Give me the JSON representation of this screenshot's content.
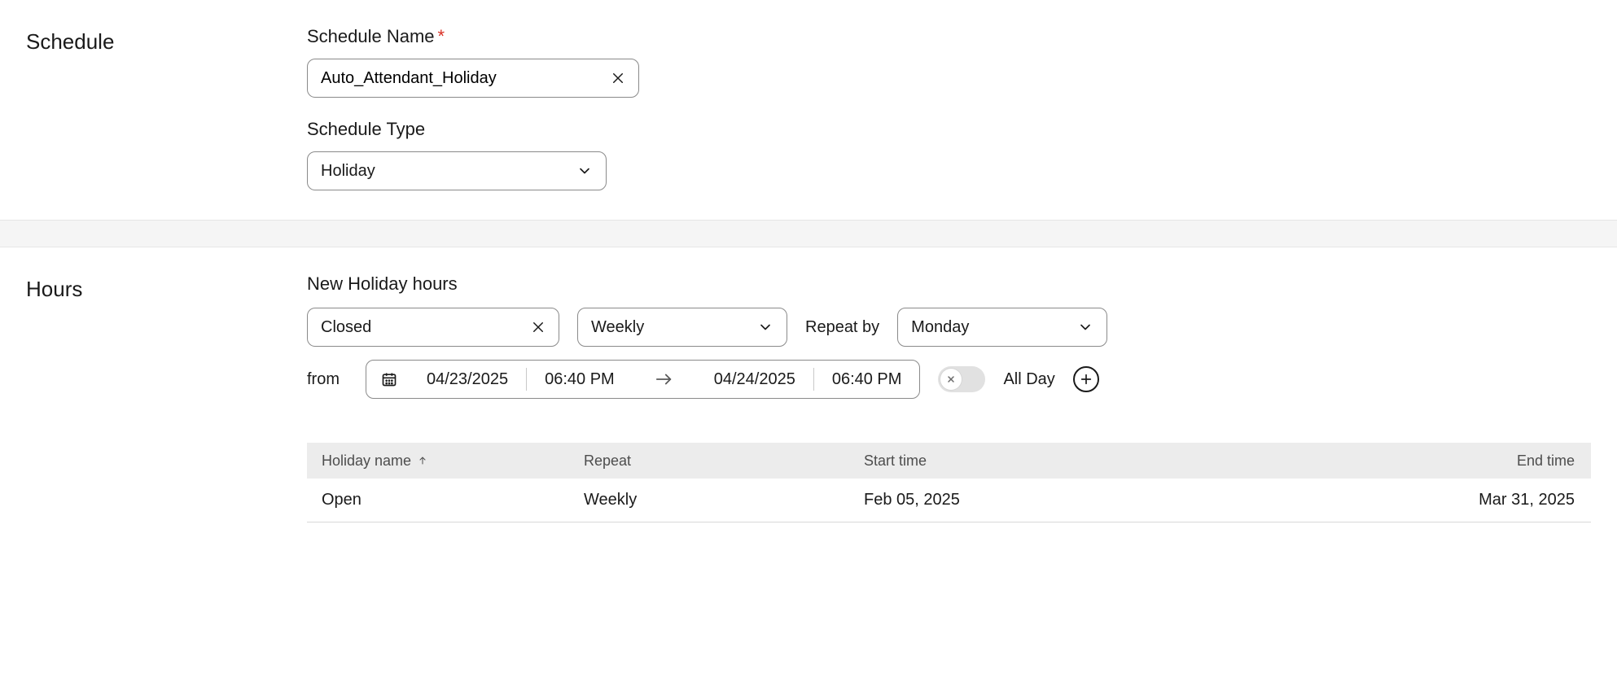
{
  "schedule": {
    "section_label": "Schedule",
    "name_label": "Schedule Name",
    "name_value": "Auto_Attendant_Holiday",
    "type_label": "Schedule Type",
    "type_value": "Holiday"
  },
  "hours": {
    "section_label": "Hours",
    "subheading": "New Holiday hours",
    "status_value": "Closed",
    "frequency_value": "Weekly",
    "repeat_by_label": "Repeat by",
    "repeat_day_value": "Monday",
    "from_label": "from",
    "start_date": "04/23/2025",
    "start_time": "06:40 PM",
    "end_date": "04/24/2025",
    "end_time": "06:40 PM",
    "all_day_label": "All Day"
  },
  "table": {
    "columns": {
      "name": "Holiday name",
      "repeat": "Repeat",
      "start": "Start time",
      "end": "End time"
    },
    "rows": [
      {
        "name": "Open",
        "repeat": "Weekly",
        "start": "Feb 05, 2025",
        "end": "Mar 31, 2025"
      }
    ]
  }
}
